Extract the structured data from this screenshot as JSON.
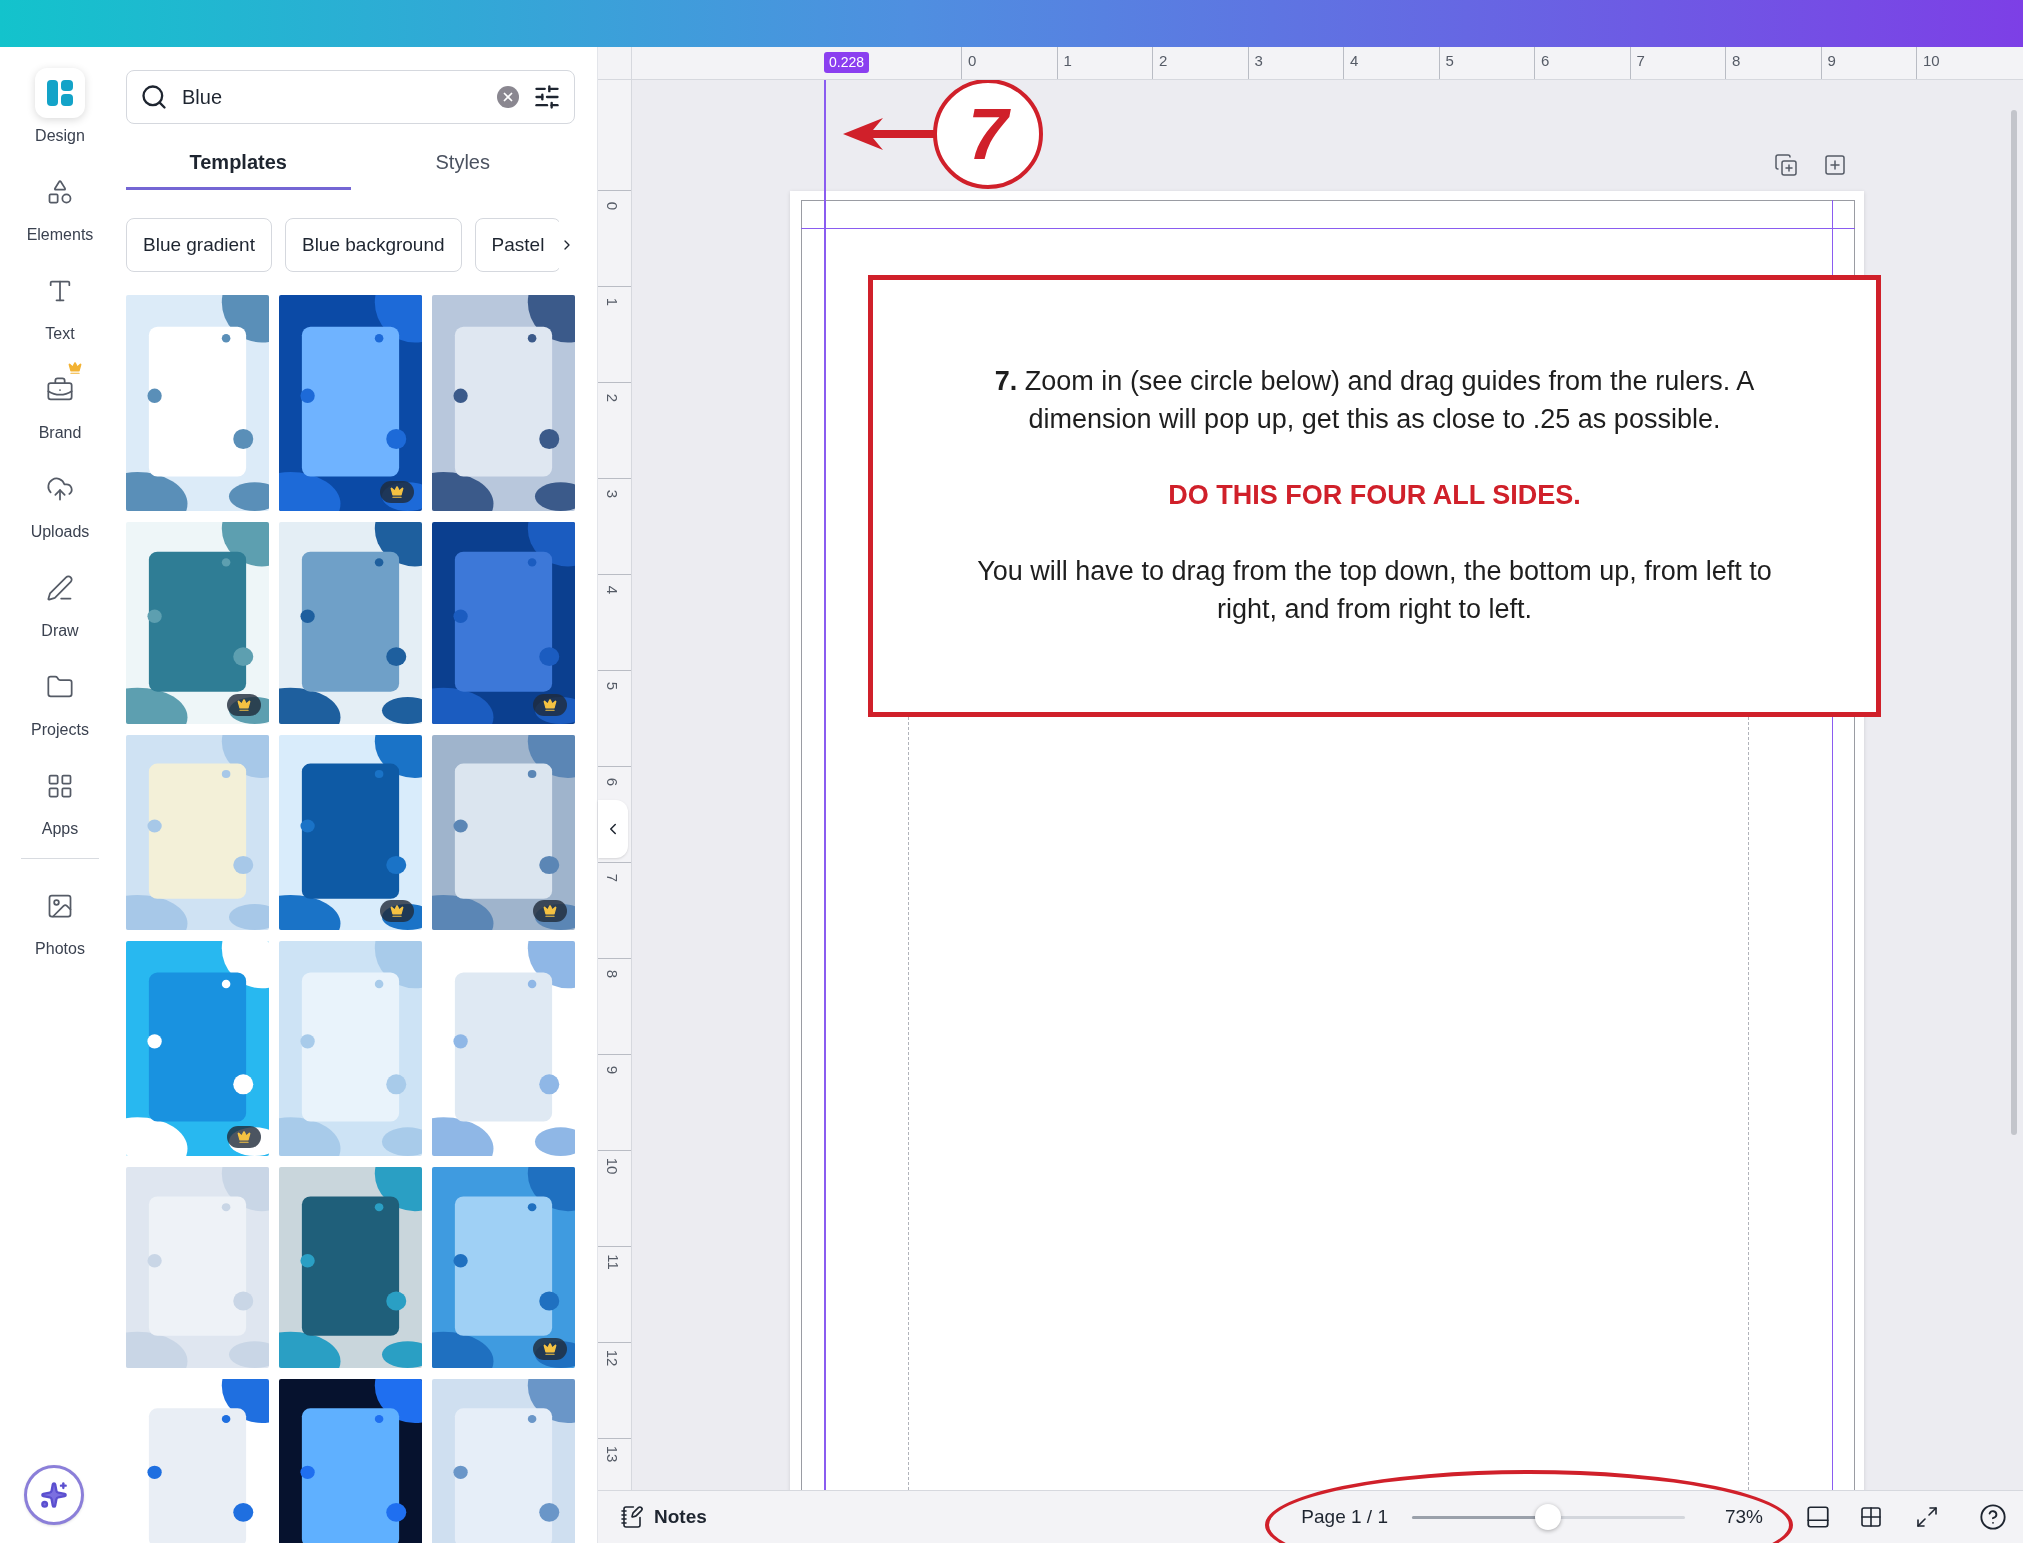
{
  "rail": {
    "primary": [
      {
        "label": "Design",
        "selected": true,
        "premium": false
      },
      {
        "label": "Elements",
        "selected": false,
        "premium": false
      },
      {
        "label": "Text",
        "selected": false,
        "premium": false
      },
      {
        "label": "Brand",
        "selected": false,
        "premium": true
      },
      {
        "label": "Uploads",
        "selected": false,
        "premium": false
      },
      {
        "label": "Draw",
        "selected": false,
        "premium": false
      },
      {
        "label": "Projects",
        "selected": false,
        "premium": false
      },
      {
        "label": "Apps",
        "selected": false,
        "premium": false
      }
    ],
    "secondary": [
      {
        "label": "Photos",
        "selected": false,
        "premium": false
      }
    ]
  },
  "search": {
    "value": "Blue"
  },
  "tabs": [
    {
      "label": "Templates",
      "selected": true
    },
    {
      "label": "Styles",
      "selected": false
    }
  ],
  "chips": [
    "Blue gradient",
    "Blue background",
    "Pastel"
  ],
  "templates": [
    {
      "items": [
        {
          "kind": "picture",
          "premium": false
        },
        {
          "kind": "picture",
          "premium": true
        },
        {
          "kind": "picture",
          "premium": false
        }
      ]
    },
    {
      "items": [
        {
          "kind": "picture",
          "premium": true
        },
        {
          "kind": "picture",
          "premium": false
        },
        {
          "kind": "picture",
          "premium": true
        }
      ]
    },
    {
      "items": [
        {
          "kind": "picture",
          "premium": false
        },
        {
          "kind": "picture",
          "premium": true
        },
        {
          "kind": "picture",
          "premium": true
        }
      ]
    },
    {
      "items": [
        {
          "kind": "picture",
          "premium": true
        },
        {
          "kind": "picture",
          "premium": false
        },
        {
          "kind": "picture",
          "premium": false
        }
      ]
    },
    {
      "items": [
        {
          "kind": "picture",
          "premium": false
        },
        {
          "kind": "picture",
          "premium": false
        },
        {
          "kind": "picture",
          "premium": true
        }
      ]
    },
    {
      "items": [
        {
          "kind": "picture"
        },
        {
          "kind": "picture"
        },
        {
          "kind": "picture"
        }
      ]
    }
  ],
  "ruler": {
    "guide_reading": "0.228",
    "x_labels": [
      "0",
      "1",
      "2",
      "3",
      "4",
      "5",
      "6",
      "7",
      "8",
      "9",
      "10"
    ],
    "y_labels": [
      "0",
      "1",
      "2",
      "3",
      "4",
      "5",
      "6",
      "7",
      "8",
      "9",
      "10",
      "11",
      "12",
      "13"
    ]
  },
  "annotation": {
    "step": "7"
  },
  "instruction": {
    "paragraph_1": "**7.** Zoom in (see circle below) and drag guides from the rulers. A dimension will pop up, get this as close to .25 as possible.",
    "warning": "DO THIS FOR FOUR ALL SIDES.",
    "paragraph_2": "You will have to drag from the top down, the bottom up, from left to right, and from right to left."
  },
  "bottom_bar": {
    "notes": "Notes",
    "page": "Page 1 / 1",
    "zoom": {
      "level": 0.5
    },
    "zoom_reading": "73%"
  }
}
